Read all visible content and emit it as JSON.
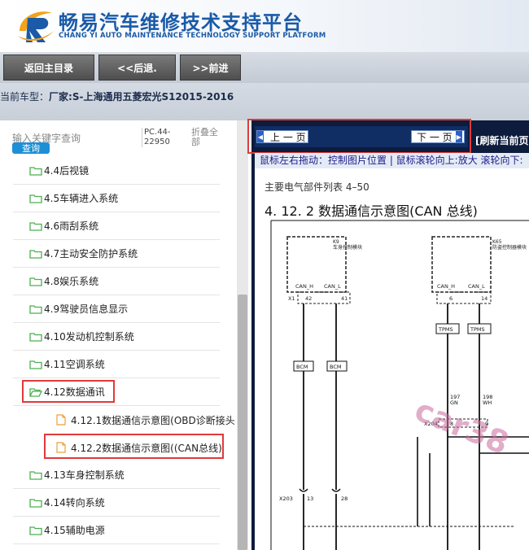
{
  "header": {
    "title": "畅易汽车维修技术支持平台",
    "subtitle": "CHANG YI AUTO MAINTENANCE TECHNOLOGY SUPPORT PLATFORM",
    "brand_color": "#1a5aa8",
    "accent_color": "#f2a21b"
  },
  "nav": {
    "home_label": "返回主目录",
    "back_label": "<<后退.",
    "forward_label": ">>前进"
  },
  "vehicle": {
    "label": "当前车型：",
    "value": "厂家:S-上海通用五菱宏光S12015-2016"
  },
  "sidebar": {
    "search_placeholder": "输入关键字查询",
    "search_button": "查询",
    "pc_code": "PC.44-22950",
    "collapse_all": "折叠全部",
    "items": [
      {
        "label": "4.4后视镜"
      },
      {
        "label": "4.5车辆进入系统"
      },
      {
        "label": "4.6雨刮系统"
      },
      {
        "label": "4.7主动安全防护系统"
      },
      {
        "label": "4.8娱乐系统"
      },
      {
        "label": "4.9驾驶员信息显示"
      },
      {
        "label": "4.10发动机控制系统"
      },
      {
        "label": "4.11空调系统"
      },
      {
        "label": "4.12数据通讯"
      },
      {
        "label": "4.13车身控制系统"
      },
      {
        "label": "4.14转向系统"
      },
      {
        "label": "4.15辅助电源"
      }
    ],
    "subitems": [
      {
        "label": "4.12.1数据通信示意图(OBD诊断接头"
      },
      {
        "label": "4.12.2数据通信示意图((CAN总线)"
      }
    ],
    "highlight_color": "#e03a3a"
  },
  "viewer": {
    "prev_label": "上 一 页",
    "next_label": "下 一 页",
    "refresh_label": "[刷新当前页",
    "hint": "鼠标左右拖动：控制图片位置 | 鼠标滚轮向上:放大  滚轮向下:",
    "doc_section": "主要电气部件列表 4–50",
    "doc_title": "4. 12. 2 数据通信示意图(CAN 总线)",
    "schematic": {
      "module1_label": "车身控制模块",
      "module1_code": "K9",
      "module2_label": "防盗控制器模块",
      "module2_code": "K65",
      "can_h": "CAN_H",
      "can_l": "CAN_L",
      "connector_x1": "X1",
      "pin_42": "42",
      "pin_41": "41",
      "pin_6": "6",
      "pin_14": "14",
      "tpms": "TPMS",
      "bcm": "BCM",
      "wire_197": "197",
      "wire_gn": "GN",
      "wire_198": "198",
      "wire_wh": "WH",
      "connector_x204": "X204",
      "pin_8": "8",
      "pin_9": "9",
      "connector_x203": "X203",
      "pin_13": "13",
      "pin_28": "28",
      "watermark": "car38"
    }
  }
}
